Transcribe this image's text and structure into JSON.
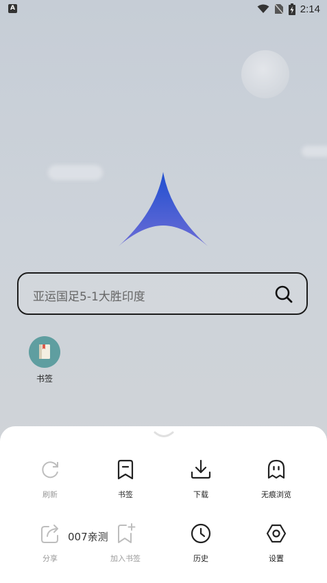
{
  "status_bar": {
    "time": "2:14",
    "app_icon_letter": "A"
  },
  "search": {
    "placeholder": "亚运国足5-1大胜印度"
  },
  "shortcuts": [
    {
      "label": "书签",
      "icon": "bookmark-book-icon"
    }
  ],
  "menu": {
    "row1": [
      {
        "label": "刷新",
        "icon": "refresh-icon",
        "enabled": false
      },
      {
        "label": "书签",
        "icon": "bookmark-icon",
        "enabled": true
      },
      {
        "label": "下载",
        "icon": "download-icon",
        "enabled": true
      },
      {
        "label": "无痕浏览",
        "icon": "ghost-icon",
        "enabled": true
      }
    ],
    "row2": [
      {
        "label": "分享",
        "icon": "share-icon",
        "enabled": false
      },
      {
        "label": "加入书签",
        "icon": "add-bookmark-icon",
        "enabled": false
      },
      {
        "label": "历史",
        "icon": "clock-icon",
        "enabled": true
      },
      {
        "label": "设置",
        "icon": "settings-icon",
        "enabled": true
      }
    ]
  },
  "watermark": "007亲测",
  "colors": {
    "logo_top": "#1f4fd0",
    "logo_bottom": "#6c6cd6",
    "bookmark_circle": "#5f9ea0",
    "sheet": "#ffffff"
  }
}
